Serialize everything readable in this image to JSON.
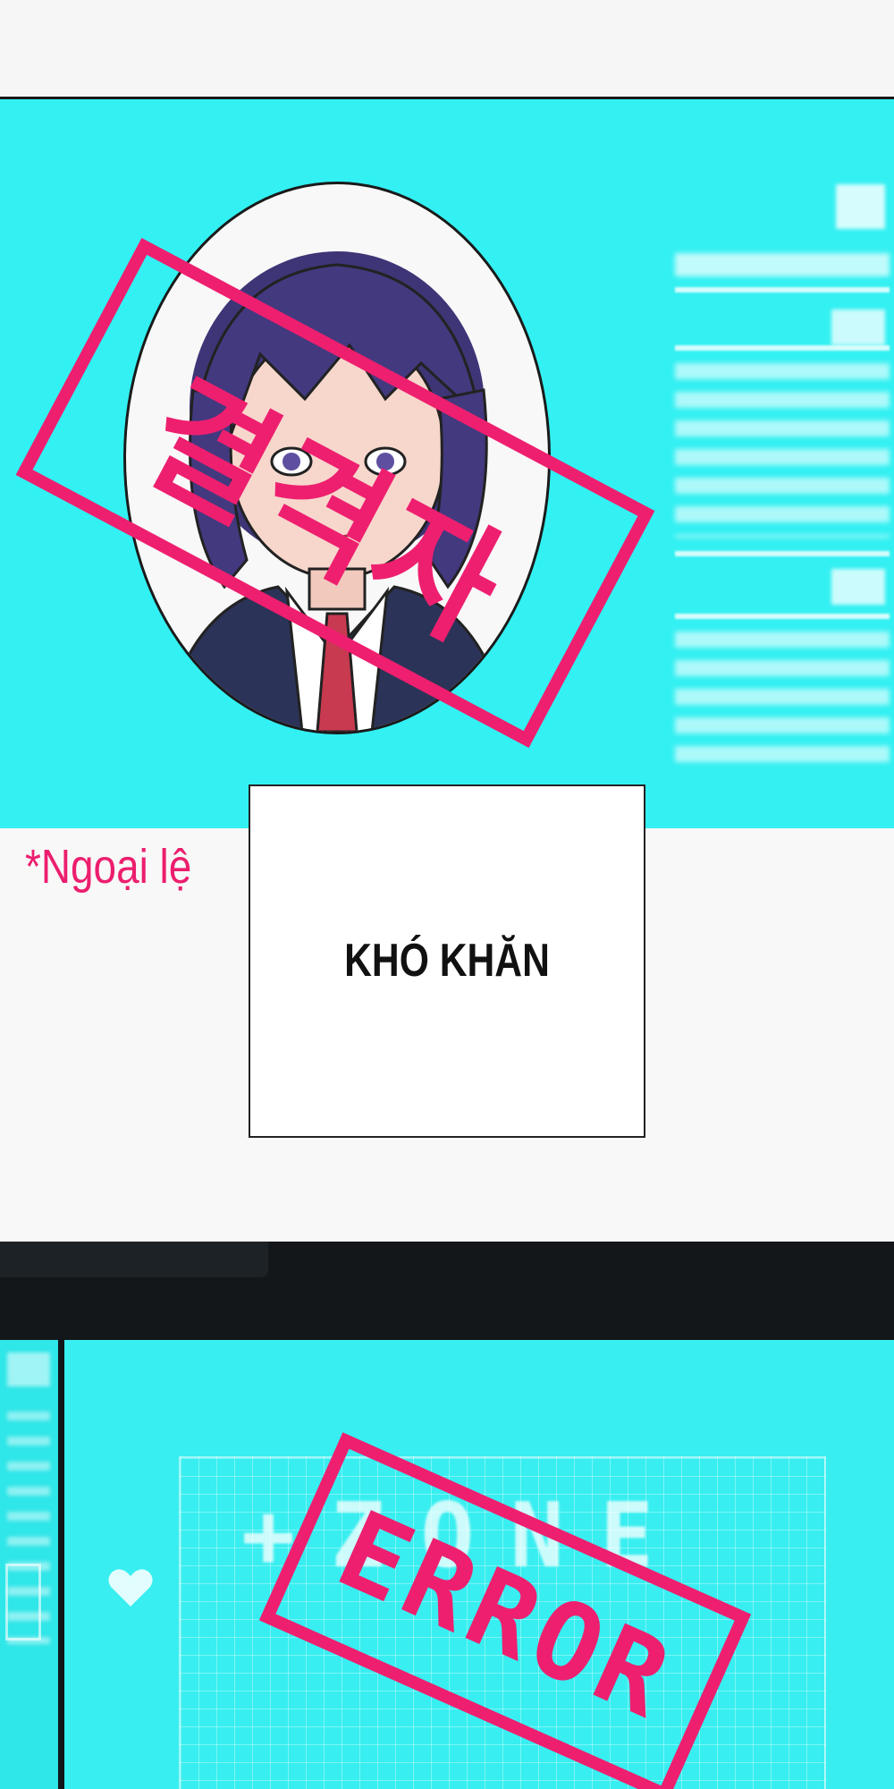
{
  "caption": {
    "text": "KHÓ KHĂN"
  },
  "note": {
    "text": "*Ngoại lệ"
  },
  "stamps": {
    "profile": "결격자",
    "screen": "ERROR"
  },
  "screen": {
    "watermark": "+ZONE"
  },
  "colors": {
    "cyan": "#33f0f2",
    "pink": "#ee1f6f",
    "dark": "#13171a"
  }
}
